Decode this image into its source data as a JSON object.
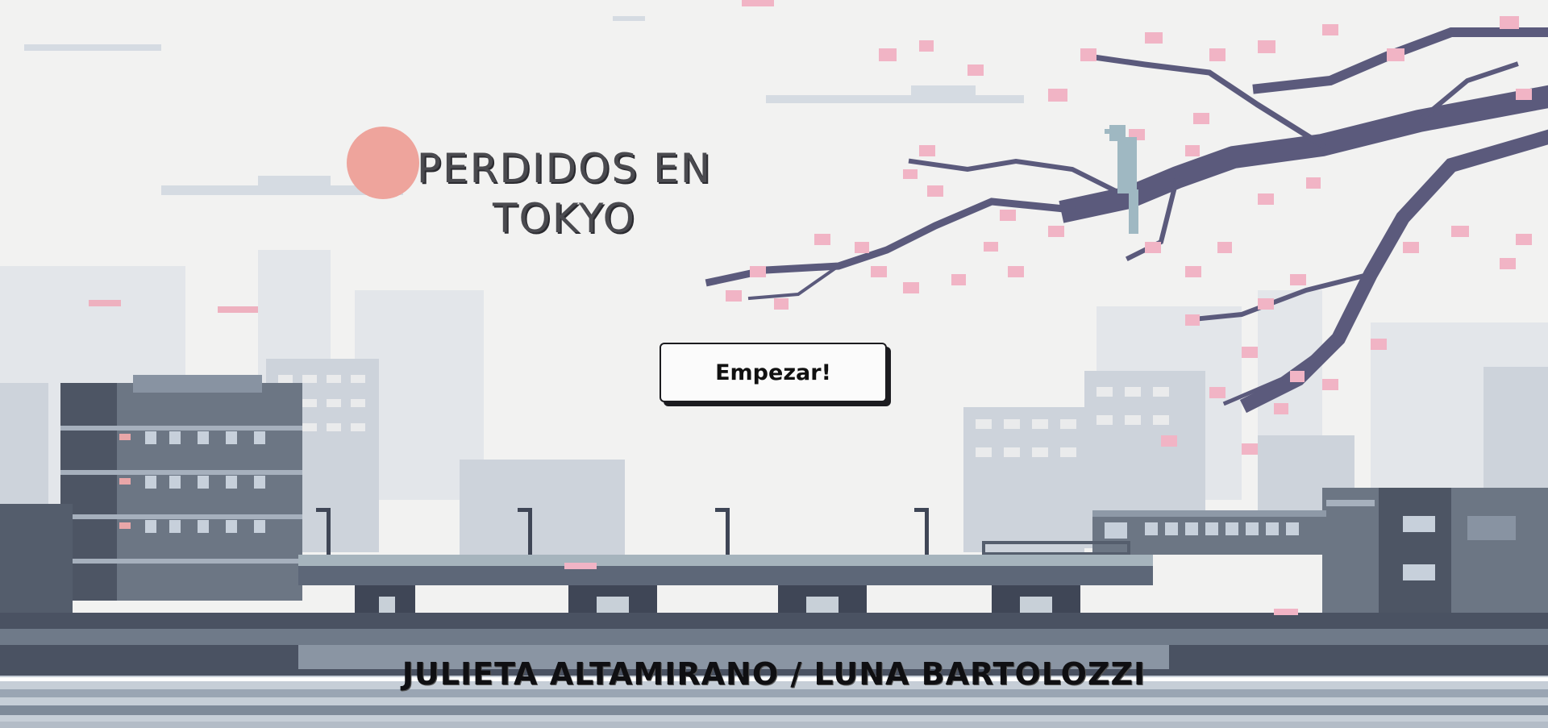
{
  "game": {
    "title_line1": "PERDIDOS EN",
    "title_line2": "TOKYO",
    "start_button": "Empezar!",
    "credits": "JULIETA ALTAMIRANO / LUNA BARTOLOZZI"
  },
  "colors": {
    "sky": "#f2f2f1",
    "sun": "#eea49c",
    "branch": "#5b5a7c",
    "blossom": "#f1b4c5",
    "bird": "#9fb8c2",
    "building_far": "#dfe3e8",
    "building_mid": "#c9d0d9",
    "building_near": "#6c7684",
    "building_dark": "#454c5a",
    "bridge": "#a6b4bd",
    "water": "#8b97a6"
  }
}
